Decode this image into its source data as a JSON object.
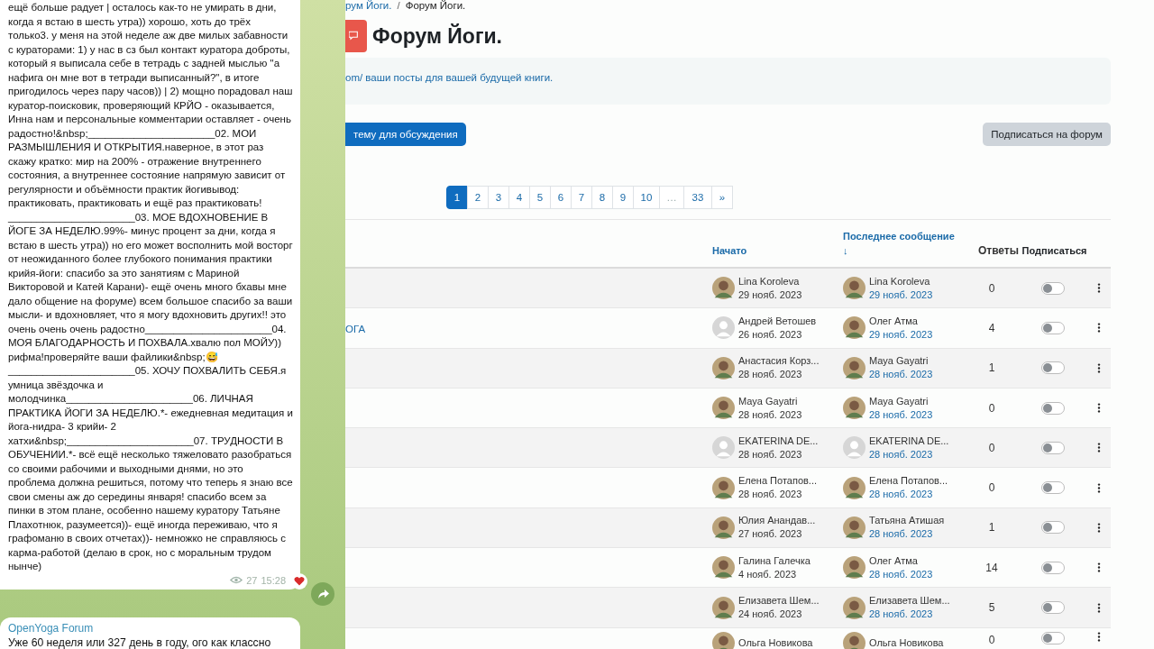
{
  "chat": {
    "message": {
      "text": "ещё больше радует | осталось как-то не умирать в дни, когда я встаю в шесть утра)) хорошо, хоть до трёх только3. у меня на этой неделе аж две милых забавности с кураторами: 1) у нас в сз был контакт куратора доброты, который я выписала себе в тетрадь с задней мыслью \"а нафига он мне вот в тетради выписанный?\", в итоге пригодилось через пару часов)) | 2) мощно порадовал наш куратор-поисковик, проверяющий КРЙО - оказывается, Инна нам и персональные комментарии оставляет - очень радостно!&nbsp;______________________02. МОИ РАЗМЫШЛЕНИЯ И ОТКРЫТИЯ.наверное, в этот раз скажу кратко: мир на 200% - отражение внутреннего состояния, а внутреннее состояние напрямую зависит от регулярности и объёмности практик йогивывод: практиковать, практиковать и ещё раз практиковать! ______________________03. МОЕ ВДОХНОВЕНИЕ В ЙОГЕ ЗА НЕДЕЛЮ.99%- минус процент за дни, когда я встаю в шесть утра)) но его может восполнить мой восторг от неожиданного более глубокого понимания практики крийя-йоги: спасибо за это занятиям с Мариной Викторовой и Катей Карани)- ещё очень много бхавы мне дало общение на форуме) всем большое спасибо за ваши мысли- и вдохновляет, что я могу вдохновить других!! это очень очень очень радостно______________________04. МОЯ БЛАГОДАРНОСТЬ И ПОХВАЛА.хвалю пол МОЙУ)) рифма!проверяйте ваши файлики&nbsp;😅______________________05. ХОЧУ ПОХВАЛИТЬ СЕБЯ.я умница звёздочка и молодчинка______________________06. ЛИЧНАЯ ПРАКТИКА ЙОГИ ЗА НЕДЕЛЮ.*- ежедневная медитация и йога-нидра- 3 крийи- 2 хатхи&nbsp;______________________07. ТРУДНОСТИ В ОБУЧЕНИИ.*- всё ещё несколько тяжеловато разобраться со своими рабочими и выходными днями, но это проблема должна решиться, потому что теперь я знаю все свои смены аж до середины января! спасибо всем за пинки в этом плане, особенно нашему куратору Татьяне Плахотнюк, разумеется))- ещё иногда переживаю, что я графоманю в своих отчетах))- немножко не справляюсь с карма-работой (делаю в срок, но с моральным трудом нынче)",
      "views": "27",
      "time": "15:28",
      "reacted": true
    },
    "next_message": {
      "sender": "OpenYoga Forum",
      "text": "Уже 60 неделя или 327 день в году, ого как классно"
    }
  },
  "page": {
    "breadcrumb_separator": "/",
    "breadcrumb": [
      {
        "label": "рум Йоги.",
        "link": true
      },
      {
        "label": "Форум Йоги.",
        "link": false
      }
    ],
    "title": "Форум Йоги.",
    "intro": "om/ ваши посты для вашей будущей книги.",
    "add_button": "тему для обсуждения",
    "subscribe_button": "Подписаться на форум",
    "pagination": [
      {
        "label": "1",
        "selected": true
      },
      {
        "label": "2",
        "selected": false
      },
      {
        "label": "3",
        "selected": false
      },
      {
        "label": "4",
        "selected": false
      },
      {
        "label": "5",
        "selected": false
      },
      {
        "label": "6",
        "selected": false
      },
      {
        "label": "7",
        "selected": false
      },
      {
        "label": "8",
        "selected": false
      },
      {
        "label": "9",
        "selected": false
      },
      {
        "label": "10",
        "selected": false
      },
      {
        "label": "…",
        "selected": false
      },
      {
        "label": "33",
        "selected": false
      },
      {
        "label": "»",
        "selected": false
      }
    ],
    "table": {
      "columns": [
        "Начато",
        "Последнее сообщение ↓",
        "Ответы",
        "Подписаться"
      ],
      "rows": [
        {
          "starter": "Lina Koroleva",
          "started": "29 нояб. 2023",
          "last_author": "Lina Koroleva",
          "last_date": "29 нояб. 2023",
          "replies": "0",
          "subscribed": false
        },
        {
          "topic": "ОГА",
          "starter": "Андрей Ветошев",
          "started": "26 нояб. 2023",
          "starter_avatar": {
            "kind": "default"
          },
          "last_author": "Олег Атма",
          "last_date": "29 нояб. 2023",
          "replies": "4",
          "subscribed": false
        },
        {
          "starter": "Анастасия Корз...",
          "started": "28 нояб. 2023",
          "last_author": "Maya Gayatri",
          "last_date": "28 нояб. 2023",
          "replies": "1",
          "subscribed": false
        },
        {
          "starter": "Maya Gayatri",
          "started": "28 нояб. 2023",
          "last_author": "Maya Gayatri",
          "last_date": "28 нояб. 2023",
          "replies": "0",
          "subscribed": false
        },
        {
          "starter": "EKATERINA DE...",
          "started": "28 нояб. 2023",
          "starter_avatar": {
            "kind": "default"
          },
          "last_author": "EKATERINA DE...",
          "last_date": "28 нояб. 2023",
          "last_avatar": {
            "kind": "default"
          },
          "replies": "0",
          "subscribed": false
        },
        {
          "starter": "Елена Потапов...",
          "started": "28 нояб. 2023",
          "last_author": "Елена Потапов...",
          "last_date": "28 нояб. 2023",
          "replies": "0",
          "subscribed": false
        },
        {
          "starter": "Юлия Анандав...",
          "started": "27 нояб. 2023",
          "last_author": "Татьяна Атишая",
          "last_date": "28 нояб. 2023",
          "replies": "1",
          "subscribed": false
        },
        {
          "starter": "Галина Галечка",
          "started": "4 нояб. 2023",
          "last_author": "Олег Атма",
          "last_date": "28 нояб. 2023",
          "replies": "14",
          "subscribed": false
        },
        {
          "starter": "Елизавета Шем...",
          "started": "24 нояб. 2023",
          "last_author": "Елизавета Шем...",
          "last_date": "28 нояб. 2023",
          "replies": "5",
          "subscribed": false
        },
        {
          "starter": "Ольга Новикова",
          "last_author": "Ольга Новикова",
          "replies": "0",
          "subscribed": false
        }
      ]
    }
  }
}
